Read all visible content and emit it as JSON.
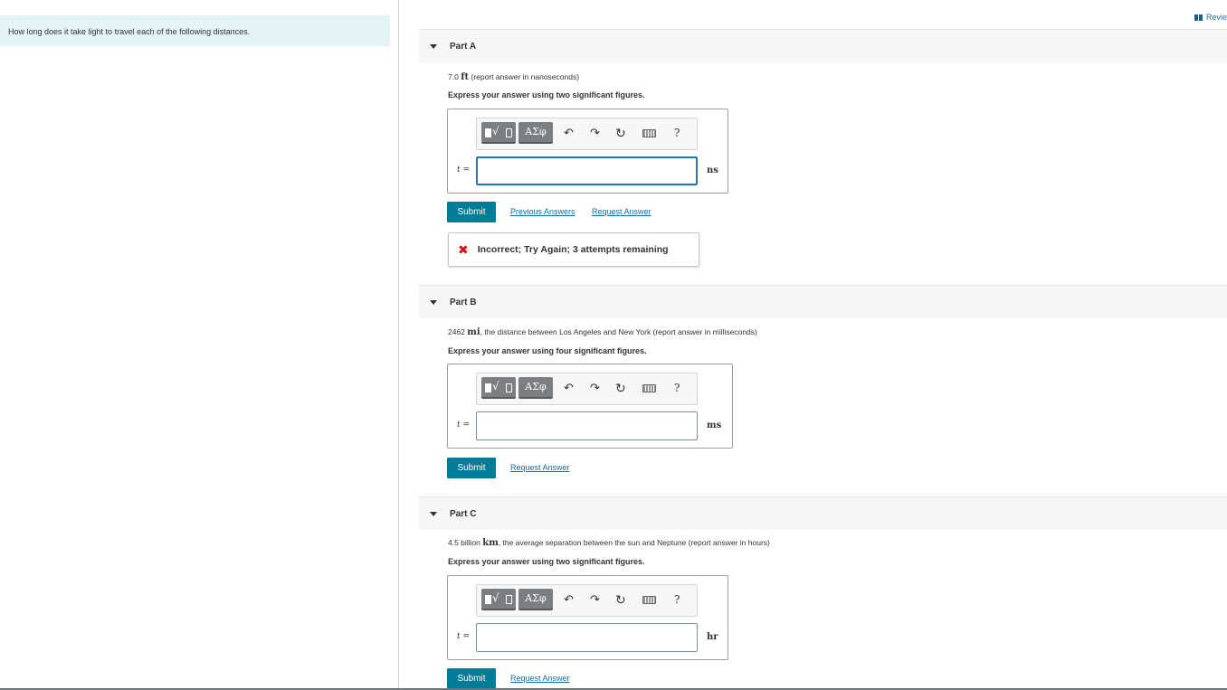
{
  "prompt": "How long does it take light to travel each of the following distances.",
  "review": {
    "label": "Revie"
  },
  "parts": [
    {
      "title": "Part A",
      "question_num": "7.0",
      "question_unit": "ft",
      "question_rest": "(report answer in nanoseconds)",
      "instruction": "Express your answer using two significant figures.",
      "variable": "t",
      "equals": "=",
      "input_value": "",
      "unit": "ns",
      "toolbar": {
        "templates_label": "√",
        "symbols_label": "ΑΣφ",
        "help_label": "?"
      },
      "submit_label": "Submit",
      "previous_answers_label": "Previous Answers",
      "request_answer_label": "Request Answer",
      "feedback": "Incorrect; Try Again; 3 attempts remaining"
    },
    {
      "title": "Part B",
      "question_num": "2462",
      "question_unit": "mi",
      "question_rest": ", the distance between Los Angeles and New York (report answer in milliseconds)",
      "instruction": "Express your answer using four significant figures.",
      "variable": "t",
      "equals": "=",
      "input_value": "",
      "unit": "ms",
      "toolbar": {
        "templates_label": "√",
        "symbols_label": "ΑΣφ",
        "help_label": "?"
      },
      "submit_label": "Submit",
      "request_answer_label": "Request Answer"
    },
    {
      "title": "Part C",
      "question_num": "4.5 billion",
      "question_unit": "km",
      "question_rest": ", the average separation between the sun and Neptune (report answer in hours)",
      "instruction": "Express your answer using two significant figures.",
      "variable": "t",
      "equals": "=",
      "input_value": "",
      "unit": "hr",
      "toolbar": {
        "templates_label": "√",
        "symbols_label": "ΑΣφ",
        "help_label": "?"
      },
      "submit_label": "Submit",
      "request_answer_label": "Request Answer"
    }
  ],
  "colors": {
    "prompt_bg": "#e4f3f5",
    "submit_bg": "#007c99",
    "link": "#1a6ca3",
    "error": "#d6111a",
    "focus": "#2479b5"
  }
}
